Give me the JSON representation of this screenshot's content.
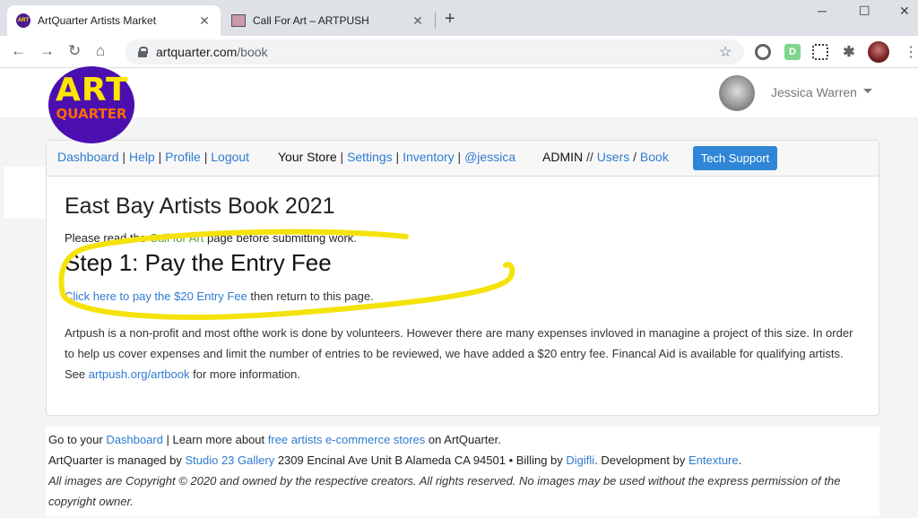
{
  "browser": {
    "tabs": [
      {
        "title": "ArtQuarter Artists Market",
        "favicon": "ART"
      },
      {
        "title": "Call For Art – ARTPUSH"
      }
    ],
    "url_domain": "artquarter.com",
    "url_path": "/book",
    "extensions": [
      "D"
    ]
  },
  "site": {
    "logo_line1": "ART",
    "logo_line2": "QUARTER",
    "user_name": "Jessica Warren"
  },
  "admin_bar": {
    "dashboard": "Dashboard",
    "help": "Help",
    "profile": "Profile",
    "logout": "Logout",
    "your_store": "Your Store",
    "settings": "Settings",
    "inventory": "Inventory",
    "handle": "@jessica",
    "admin": "ADMIN",
    "users": "Users",
    "book": "Book",
    "tech_support": "Tech Support"
  },
  "content": {
    "title": "East Bay Artists Book 2021",
    "intro_before": "Please read the ",
    "intro_link": "Call for Art",
    "intro_after": " page before submitting work.",
    "step_title": "Step 1: Pay the Entry Fee",
    "pay_link": "Click here to pay the $20 Entry Fee",
    "pay_after": " then return to this page.",
    "para_before": "Artpush is a non-profit and most ofthe work is done by volunteers. However there are many expenses invloved in managine a project of this size. In order to help us cover expenses and limit the number of entries to be reviewed, we have added a $20 entry fee. Financal Aid is available for qualifying artists. See ",
    "para_link": "artpush.org/artbook",
    "para_after": " for more information."
  },
  "footer": {
    "line1_before": "Go to your ",
    "line1_dashboard": "Dashboard",
    "line1_mid": " | Learn more about ",
    "line1_link": "free artists e-commerce stores",
    "line1_after": " on ArtQuarter.",
    "line2_before": "ArtQuarter is managed by ",
    "line2_gallery": "Studio 23 Gallery",
    "line2_mid": " 2309 Encinal Ave Unit B Alameda CA 94501 • Billing by ",
    "line2_billing": "Digifli",
    "line2_dev": ". Development by ",
    "line2_entexture": "Entexture",
    "line2_end": ".",
    "copyright": "All images are Copyright © 2020 and owned by the respective creators. All rights reserved. No images may be used without the express permission of the copyright owner."
  },
  "colors": {
    "link": "#2f7bd1",
    "highlight": "#f5e20a",
    "logo_bg": "#4b0fb0",
    "logo_text": "#ffe600",
    "tech_btn": "#2f86d6"
  }
}
